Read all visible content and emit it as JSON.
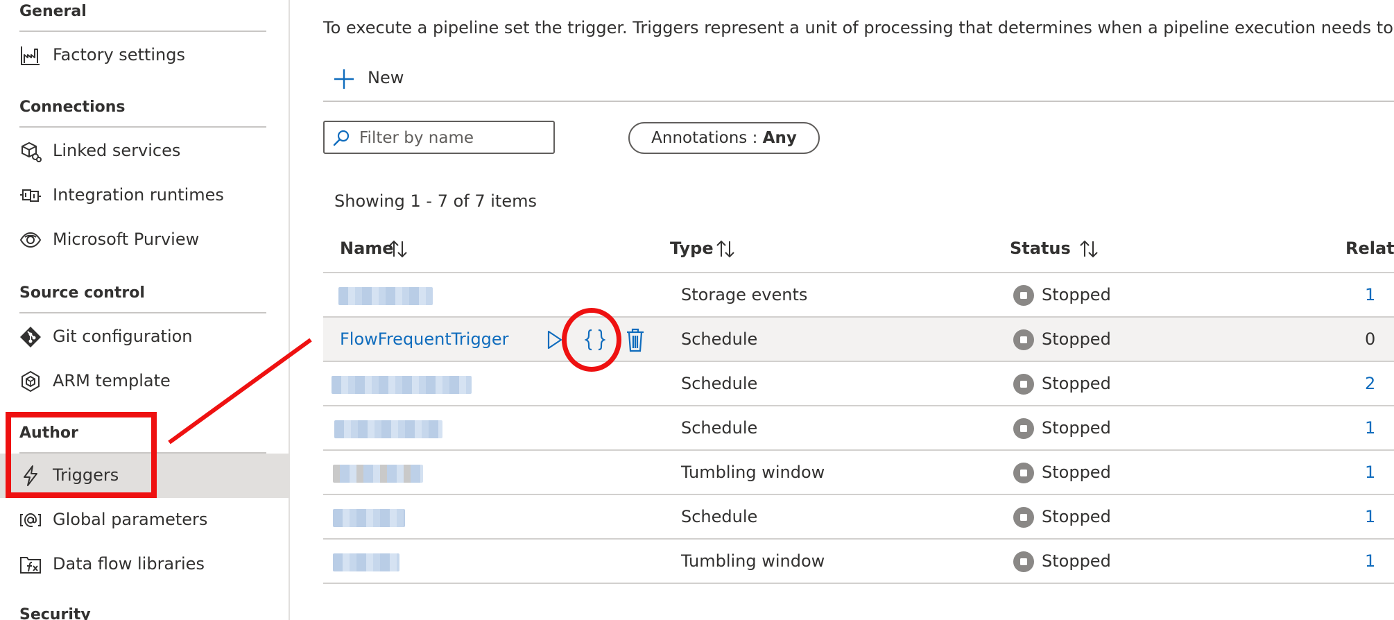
{
  "sidebar": {
    "sections": {
      "general": "General",
      "connections": "Connections",
      "source_control": "Source control",
      "author": "Author",
      "security": "Security"
    },
    "items": {
      "factory_settings": "Factory settings",
      "linked_services": "Linked services",
      "integration_runtimes": "Integration runtimes",
      "purview": "Microsoft Purview",
      "git_configuration": "Git configuration",
      "arm_template": "ARM template",
      "triggers": "Triggers",
      "global_parameters": "Global parameters",
      "data_flow_libraries": "Data flow libraries"
    }
  },
  "main": {
    "intro": "To execute a pipeline set the trigger. Triggers represent a unit of processing that determines when a pipeline execution needs to be kick",
    "new_label": "New",
    "filter_placeholder": "Filter by name",
    "annotations_label": "Annotations : ",
    "annotations_value": "Any",
    "showing": "Showing 1 - 7 of 7 items",
    "columns": {
      "name": "Name",
      "type": "Type",
      "status": "Status",
      "related": "Relate"
    },
    "rows": [
      {
        "name": "",
        "type": "Storage events",
        "status": "Stopped",
        "related": "1"
      },
      {
        "name": "FlowFrequentTrigger",
        "type": "Schedule",
        "status": "Stopped",
        "related": "0"
      },
      {
        "name": "",
        "type": "Schedule",
        "status": "Stopped",
        "related": "2"
      },
      {
        "name": "",
        "type": "Schedule",
        "status": "Stopped",
        "related": "1"
      },
      {
        "name": "",
        "type": "Tumbling window",
        "status": "Stopped",
        "related": "1"
      },
      {
        "name": "",
        "type": "Schedule",
        "status": "Stopped",
        "related": "1"
      },
      {
        "name": "",
        "type": "Tumbling window",
        "status": "Stopped",
        "related": "1"
      }
    ]
  },
  "colors": {
    "accent": "#0f6cbd",
    "callout": "#ee1111",
    "active_nav": "#e1dfdd",
    "status_stopped": "#8a8886"
  },
  "icons": {
    "factory_settings": "factory-icon",
    "linked_services": "linked-services-icon",
    "integration_runtimes": "integration-runtime-icon",
    "purview": "purview-eye-icon",
    "git_configuration": "git-icon",
    "arm_template": "arm-template-icon",
    "triggers": "lightning-icon",
    "global_parameters": "global-parameters-icon",
    "data_flow_libraries": "data-flow-library-icon",
    "new": "plus-icon",
    "filter": "search-icon",
    "sort": "sort-arrows-icon",
    "status": "stopped-status-icon",
    "run": "play-icon",
    "code": "code-braces-icon",
    "delete": "trash-icon"
  }
}
